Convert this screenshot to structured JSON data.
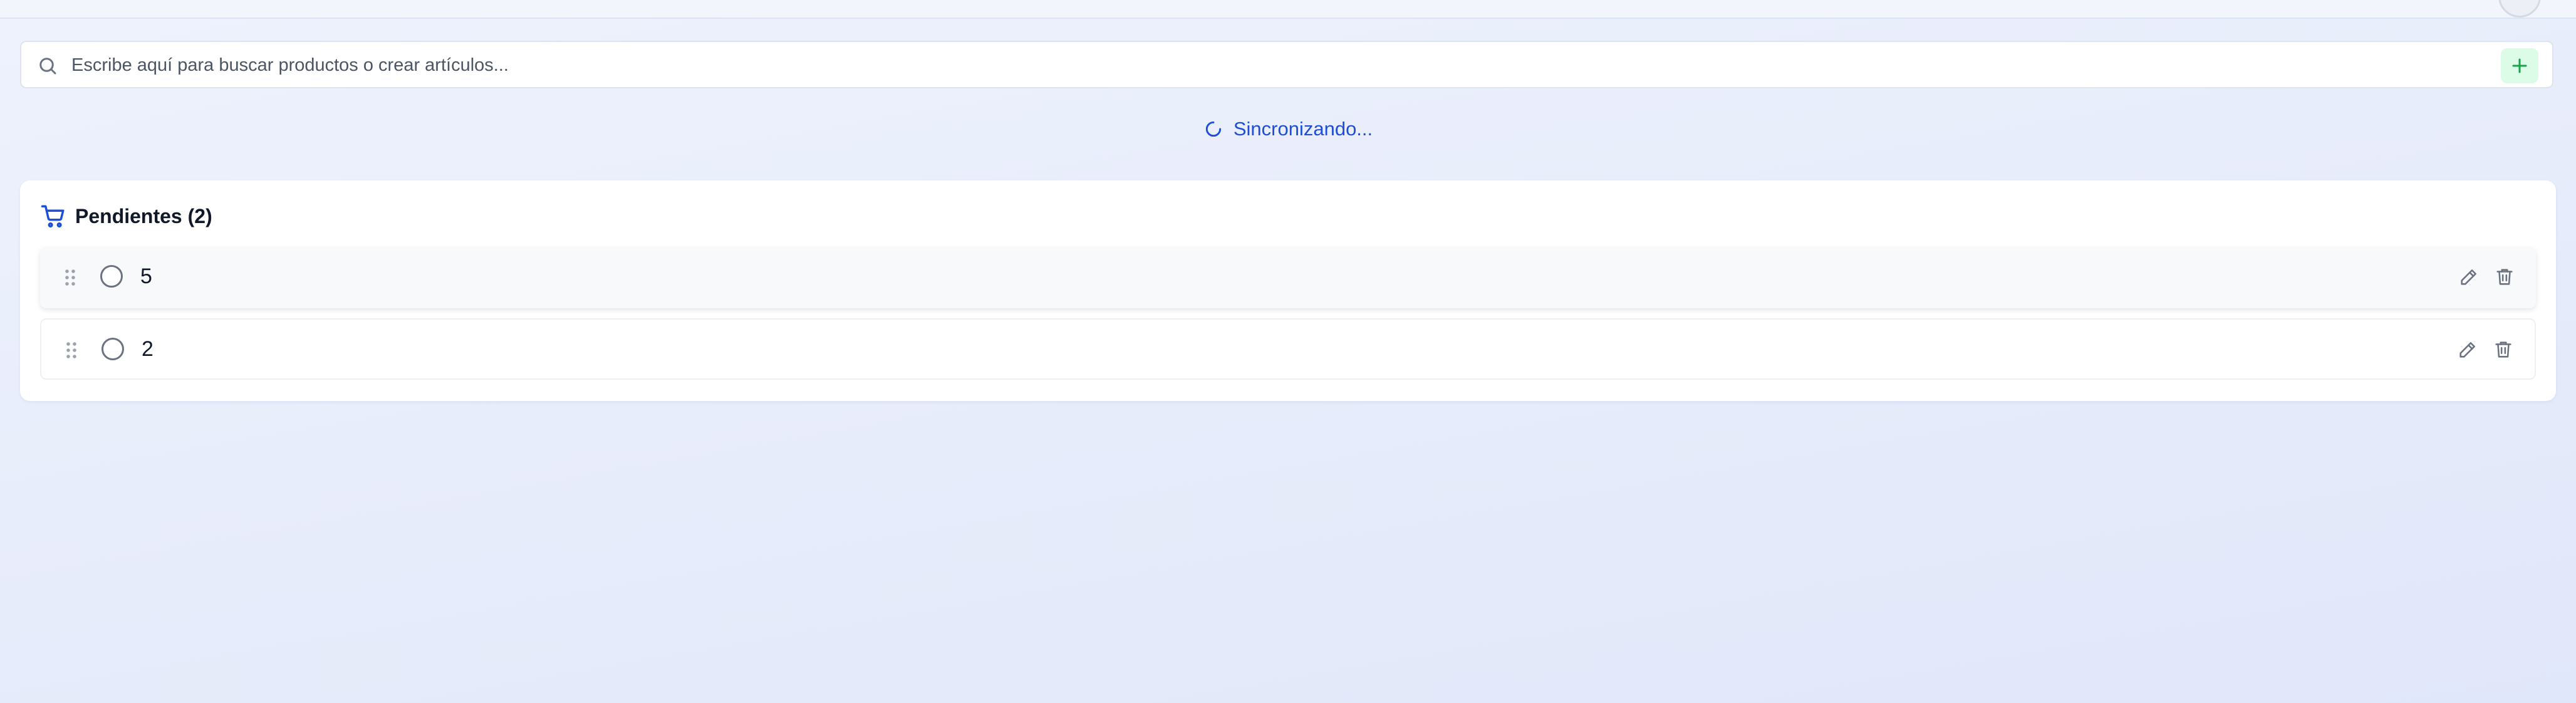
{
  "search": {
    "placeholder": "Escribe aquí para buscar productos o crear artículos...",
    "value": ""
  },
  "icons": {
    "search": "search-icon",
    "add": "plus-icon",
    "sync": "loader-icon",
    "cart": "cart-icon",
    "drag": "grip-vertical-icon",
    "edit": "pencil-icon",
    "delete": "trash-icon"
  },
  "colors": {
    "accent": "#1d4ed8",
    "add_button_bg": "#dcfce7",
    "add_button_icon": "#16a34a"
  },
  "sync": {
    "label": "Sincronizando..."
  },
  "pending": {
    "title": "Pendientes (2)",
    "items": [
      {
        "label": "5",
        "checked": false
      },
      {
        "label": "2",
        "checked": false
      }
    ]
  }
}
